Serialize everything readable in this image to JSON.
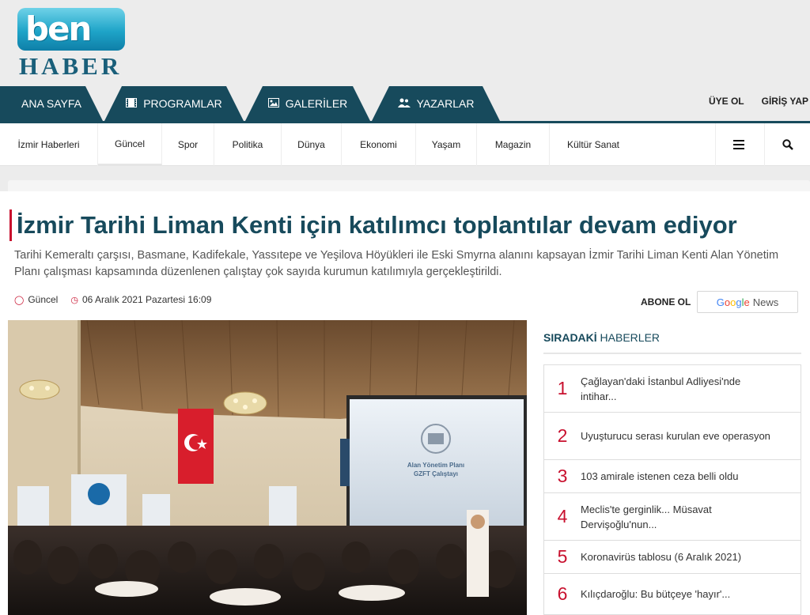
{
  "logo": {
    "top": "ben",
    "bottom": "HABER"
  },
  "main_tabs": [
    {
      "label": "ANA SAYFA",
      "icon": ""
    },
    {
      "label": "PROGRAMLAR",
      "icon": "film-icon"
    },
    {
      "label": "GALERİLER",
      "icon": "image-icon"
    },
    {
      "label": "YAZARLAR",
      "icon": "users-icon"
    }
  ],
  "auth": {
    "signup": "ÜYE OL",
    "login": "GİRİŞ YAP"
  },
  "nav": {
    "items": [
      "İzmir Haberleri",
      "Güncel",
      "Spor",
      "Politika",
      "Dünya",
      "Ekonomi",
      "Yaşam",
      "Magazin",
      "Kültür Sanat"
    ],
    "active": "Güncel",
    "menu_icon": "hamburger-icon",
    "search_icon": "search-icon"
  },
  "article": {
    "title": "İzmir Tarihi Liman Kenti için katılımcı toplantılar devam ediyor",
    "summary": "Tarihi Kemeraltı çarşısı, Basmane, Kadifekale, Yassıtepe ve Yeşilova Höyükleri ile Eski Smyrna alanını kapsayan İzmir Tarihi Liman Kenti Alan Yönetim Planı çalışması kapsamında düzenlenen çalıştay çok sayıda kurumun katılımıyla gerçekleştirildi.",
    "category": "Güncel",
    "date": "06 Aralık 2021 Pazartesi 16:09",
    "subscribe_label": "ABONE OL",
    "gnews_google": "Google",
    "gnews_news": "News",
    "photo_alt": "Alan Yönetim Planı GZFT Çalıştayı",
    "screen_text1": "Alan Yönetim Planı",
    "screen_text2": "GZFT Çalıştayı"
  },
  "sidebar": {
    "title_bold": "SIRADAKİ",
    "title_rest": " HABERLER",
    "items": [
      {
        "num": "1",
        "text": "Çağlayan'daki İstanbul Adliyesi'nde intihar..."
      },
      {
        "num": "2",
        "text": "Uyuşturucu serası kurulan eve operasyon"
      },
      {
        "num": "3",
        "text": "103 amirale istenen ceza belli oldu"
      },
      {
        "num": "4",
        "text": "Meclis'te gerginlik... Müsavat Dervişoğlu'nun..."
      },
      {
        "num": "5",
        "text": "Koronavirüs tablosu (6 Aralık 2021)"
      },
      {
        "num": "6",
        "text": "Kılıçdaroğlu: Bu bütçeye 'hayır'..."
      }
    ]
  },
  "colors": {
    "primary": "#174a5c",
    "accent": "#c8102e",
    "bg": "#ececec"
  }
}
